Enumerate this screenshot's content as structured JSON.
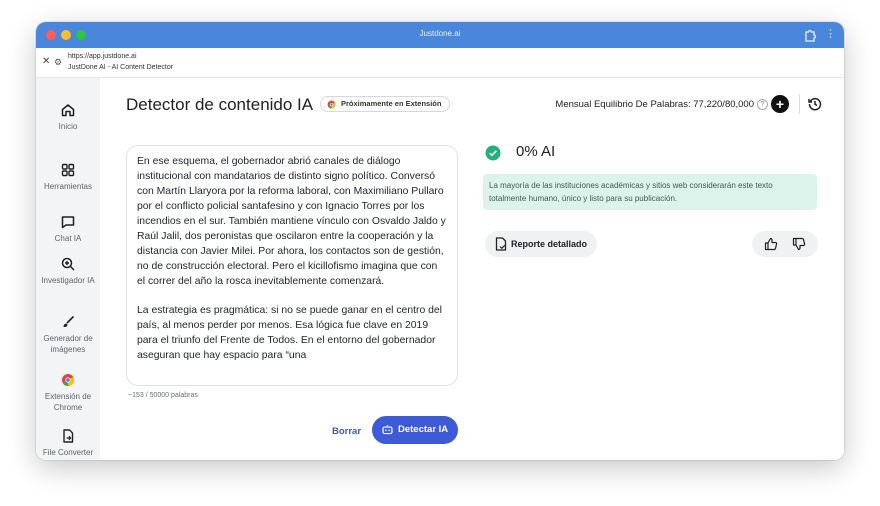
{
  "window": {
    "title": "Justdone.ai"
  },
  "address": {
    "url": "https://app.justdone.ai",
    "page_title": "JustDone AI - AI Content Detector"
  },
  "sidebar": {
    "items": [
      {
        "label": "Inicio",
        "icon": "home-icon"
      },
      {
        "label": "Herramientas",
        "icon": "grid-icon"
      },
      {
        "label": "Chat IA",
        "icon": "chat-icon"
      },
      {
        "label": "Investigador IA",
        "icon": "search-plus-icon"
      },
      {
        "label": "Generador de imágenes",
        "icon": "brush-icon"
      },
      {
        "label": "Extensión de Chrome",
        "icon": "chrome-icon"
      },
      {
        "label": "File Converter",
        "icon": "file-convert-icon"
      }
    ]
  },
  "header": {
    "title": "Detector de contenido IA",
    "badge": "Próximamente en Extensión",
    "balance": "Mensual Equilibrio De Palabras: 77,220/80,000"
  },
  "editor": {
    "paragraphs": [
      "En ese esquema, el gobernador abrió canales de diálogo institucional con mandatarios de distinto signo político. Conversó con Martín Llaryora por la reforma laboral, con Maximiliano Pullaro por el conflicto policial santafesino y con Ignacio Torres por los incendios en el sur. También mantiene vínculo con Osvaldo Jaldo y Raúl Jalil, dos peronistas que oscilaron entre la cooperación y la distancia con Javier Milei. Por ahora, los contactos son de gestión, no de construcción electoral. Pero el kicillofismo imagina que con el correr del año la rosca inevitablemente comenzará.",
      "La estrategia es pragmática: si no se puede ganar en el centro del país, al menos perder por menos. Esa lógica fue clave en 2019 para el triunfo del Frente de Todos. En el entorno del gobernador aseguran que hay espacio para “una"
    ],
    "word_count": "~153 / 50000 palabras",
    "clear_label": "Borrar",
    "detect_label": "Detectar IA"
  },
  "result": {
    "score": "0% AI",
    "note": "La mayoría de las instituciones académicas y sitios web considerarán este texto totalmente humano, único y listo para su publicación.",
    "report_label": "Reporte detallado"
  },
  "colors": {
    "accent": "#3d5bd8",
    "titlebar": "#4a86d9",
    "success": "#22b07d",
    "note_bg": "#dcf3ec"
  }
}
